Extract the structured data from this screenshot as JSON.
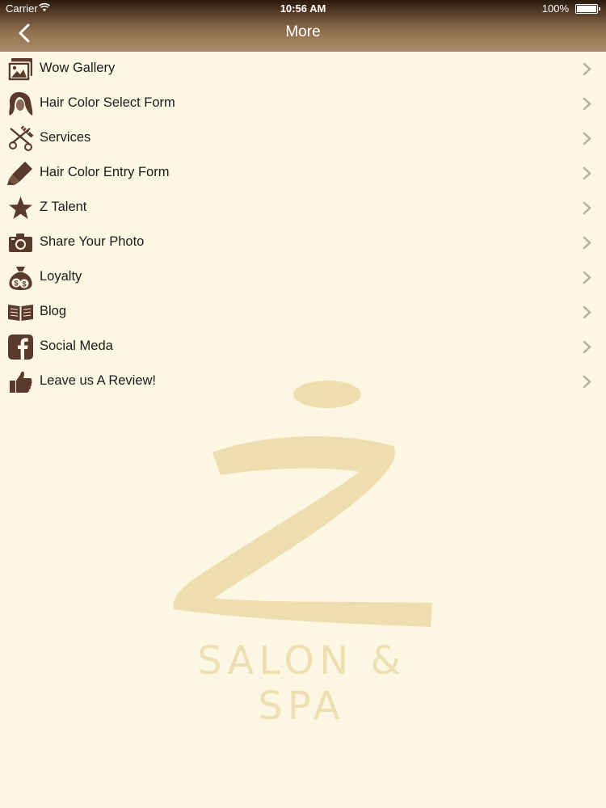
{
  "status_bar": {
    "carrier": "Carrier",
    "time": "10:56 AM",
    "battery": "100%"
  },
  "nav": {
    "title": "More",
    "back_icon": "chevron-left-icon"
  },
  "menu": {
    "items": [
      {
        "label": "Wow Gallery",
        "icon": "gallery-icon"
      },
      {
        "label": "Hair Color Select Form",
        "icon": "hair-icon"
      },
      {
        "label": "Services",
        "icon": "scissors-comb-icon"
      },
      {
        "label": "Hair Color Entry Form",
        "icon": "color-bottle-icon"
      },
      {
        "label": "Z Talent",
        "icon": "star-icon"
      },
      {
        "label": "Share Your Photo",
        "icon": "camera-icon"
      },
      {
        "label": "Loyalty",
        "icon": "money-bag-icon"
      },
      {
        "label": "Blog",
        "icon": "open-book-icon"
      },
      {
        "label": "Social Meda",
        "icon": "facebook-icon"
      },
      {
        "label": "Leave us A Review!",
        "icon": "thumbs-up-icon"
      }
    ]
  },
  "watermark": {
    "text": "SALON & SPA"
  },
  "colors": {
    "background": "#FCF7E2",
    "icon_brown": "#5a3a2c",
    "chevron": "#b5b0a0",
    "watermark": "#E8D5A0"
  }
}
